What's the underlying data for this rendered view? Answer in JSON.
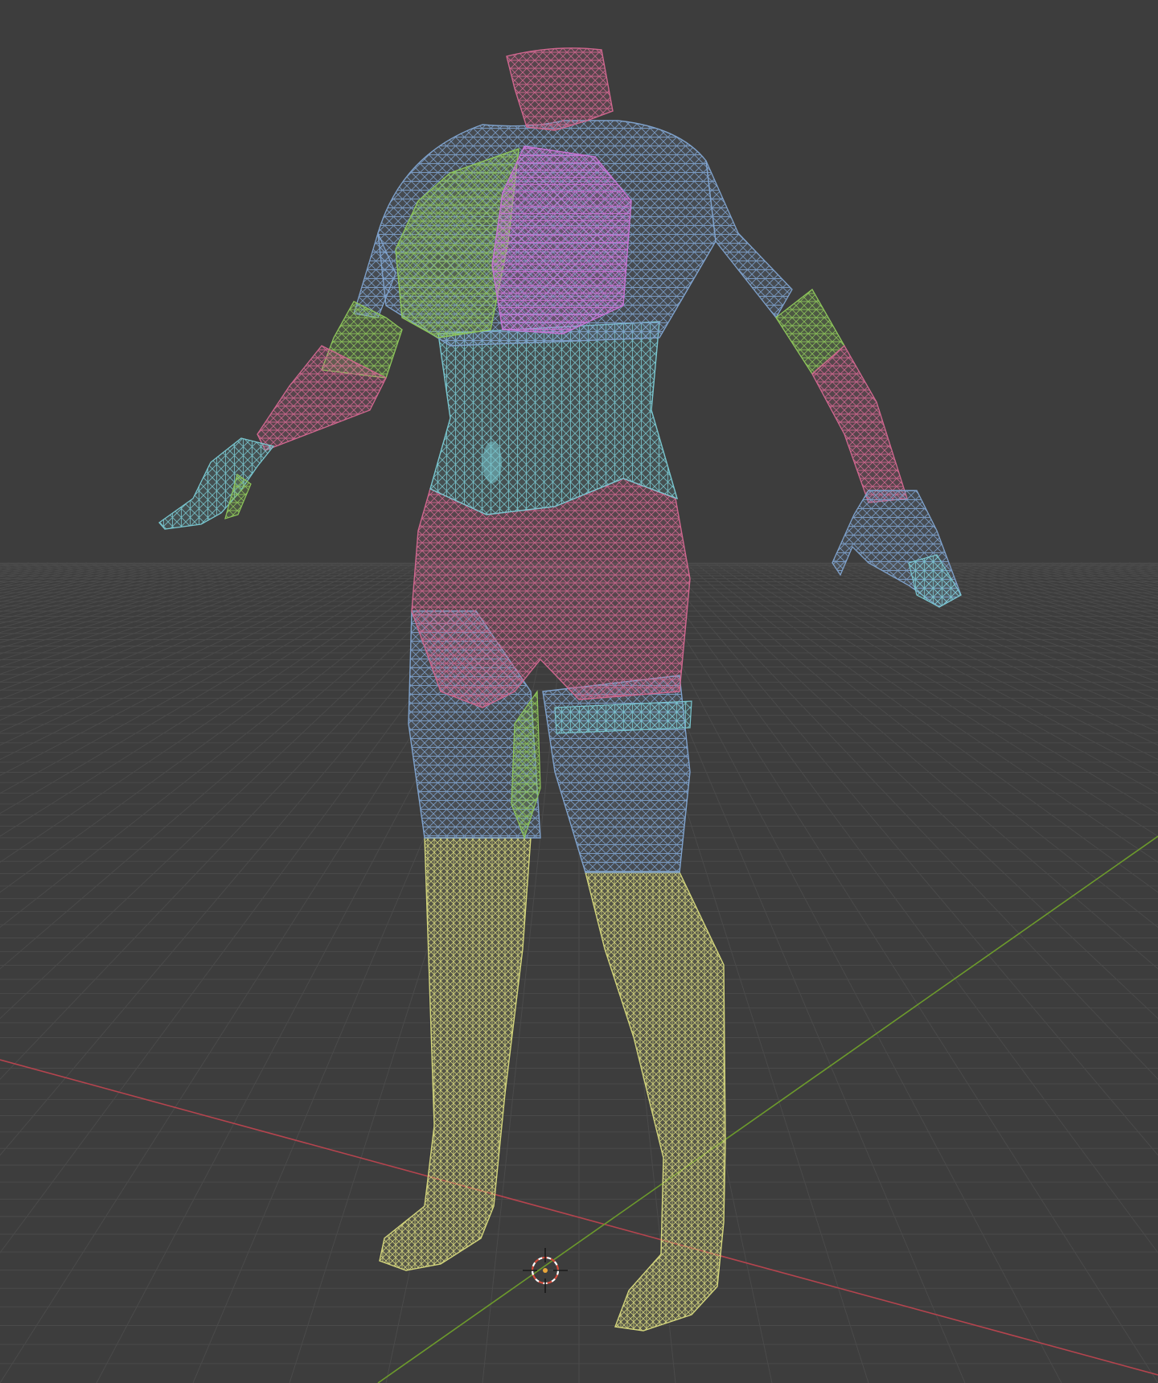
{
  "viewport": {
    "background": "#3d3d3d",
    "grid_color": "#4a4a4a",
    "axis_x_color": "#b4444e",
    "axis_y_color": "#6c9a2c",
    "cursor_icon": "3d-cursor-icon",
    "display_mode": "wireframe"
  },
  "mesh": {
    "region_colors": {
      "pink": "#d0678f",
      "blue": "#7fa2cc",
      "cyan": "#79c6cf",
      "green": "#8dc55a",
      "magenta": "#c774d4",
      "yellow": "#d2d47c"
    }
  }
}
